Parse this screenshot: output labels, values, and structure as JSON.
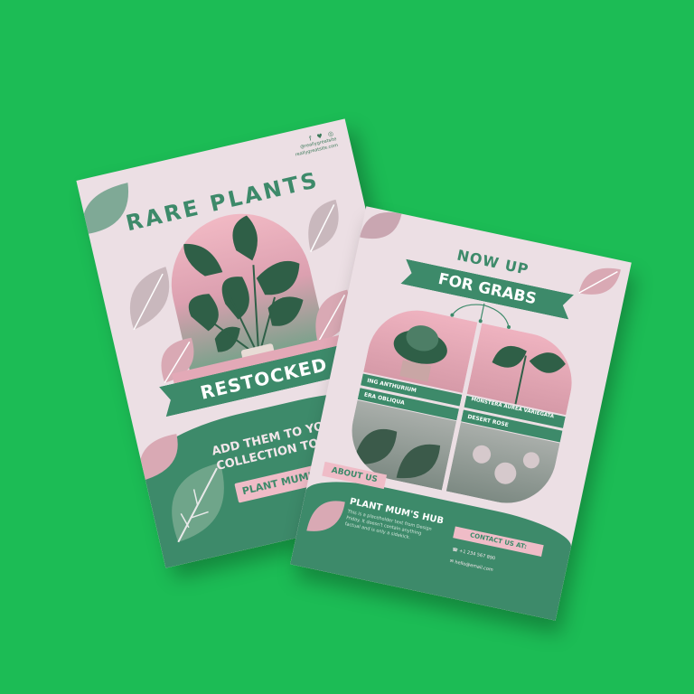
{
  "background_color": "#1cbc55",
  "accent_green": "#3d8a6a",
  "accent_pink": "#efbcc7",
  "flyer_left": {
    "social_icons": "f ♥ ◎",
    "handle": "@reallygreatsite",
    "website": "reallygreatsite.com",
    "title": "RARE PLANTS",
    "banner": "RESTOCKED",
    "tagline_1": "ADD THEM TO YOUR",
    "tagline_2": "COLLECTION TODAY",
    "brand_button": "PLANT MUM'S HUB"
  },
  "flyer_right": {
    "title_top": "NOW UP",
    "title_banner": "FOR GRABS",
    "plants": [
      "ING ANTHURIUM",
      "MONSTERA AUREA VARIEGATA",
      "ERA OBLIQUA",
      "DESERT ROSE"
    ],
    "about_label": "ABOUT US",
    "brand": "PLANT MUM'S HUB",
    "description": "This is a placeholder text from Design Friday. It doesn't contain anything factual and is only a sidekick.",
    "contact_label": "CONTACT US AT:",
    "phone": "+1 234 567 890",
    "email": "hello@email.com"
  }
}
